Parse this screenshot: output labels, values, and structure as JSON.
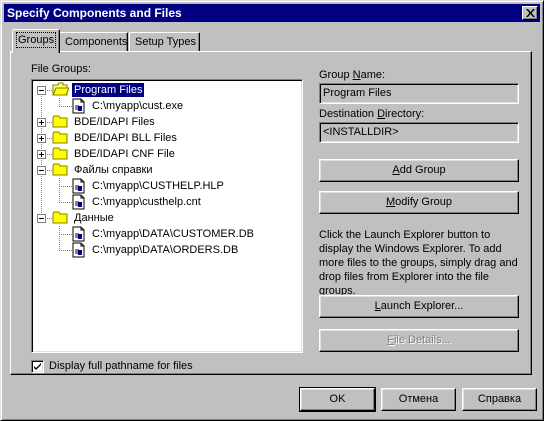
{
  "window": {
    "title": "Specify Components and Files"
  },
  "tabs": [
    {
      "label": "Groups",
      "active": true
    },
    {
      "label": "Components",
      "active": false
    },
    {
      "label": "Setup Types",
      "active": false
    }
  ],
  "file_groups": {
    "label": "File Groups:",
    "tree": [
      {
        "label": "Program Files",
        "type": "folder",
        "expanded": true,
        "selected": true
      },
      {
        "label": "C:\\myapp\\cust.exe",
        "type": "file"
      },
      {
        "label": "BDE/IDAPI Files",
        "type": "folder",
        "expanded": false
      },
      {
        "label": "BDE/IDAPI BLL Files",
        "type": "folder",
        "expanded": false
      },
      {
        "label": "BDE/IDAPI CNF File",
        "type": "folder",
        "expanded": false
      },
      {
        "label": "Файлы справки",
        "type": "folder",
        "expanded": true
      },
      {
        "label": "C:\\myapp\\CUSTHELP.HLP",
        "type": "file"
      },
      {
        "label": "C:\\myapp\\custhelp.cnt",
        "type": "file"
      },
      {
        "label": "Данные",
        "type": "folder",
        "expanded": true
      },
      {
        "label": "C:\\myapp\\DATA\\CUSTOMER.DB",
        "type": "file"
      },
      {
        "label": "C:\\myapp\\DATA\\ORDERS.DB",
        "type": "file"
      }
    ]
  },
  "group_name": {
    "label_pre": "Group ",
    "label_key": "N",
    "label_post": "ame:",
    "value": "Program Files"
  },
  "destination": {
    "label_pre": "Destination ",
    "label_key": "D",
    "label_post": "irectory:",
    "value": "<INSTALLDIR>"
  },
  "buttons": {
    "add_group": {
      "pre": "",
      "key": "A",
      "post": "dd Group"
    },
    "modify_group": {
      "pre": "",
      "key": "M",
      "post": "odify Group"
    },
    "launch_explorer": {
      "pre": "",
      "key": "L",
      "post": "aunch Explorer..."
    },
    "file_details": {
      "pre": "",
      "key": "F",
      "post": "ile Details..."
    },
    "ok": "OK",
    "cancel": "Отмена",
    "help": "Справка"
  },
  "info_text": "Click the Launch Explorer button to display the Windows Explorer. To add more files to the groups, simply drag and drop files from Explorer into the file groups.",
  "display_fullpath": {
    "label": "Display full pathname for files",
    "checked": true
  },
  "colors": {
    "face": "#c0c0c0",
    "title_bar": "#000080",
    "selection": "#000080"
  },
  "icons": {
    "folder": "folder-icon",
    "file": "file-icon",
    "close": "close-icon",
    "check": "check-icon"
  }
}
